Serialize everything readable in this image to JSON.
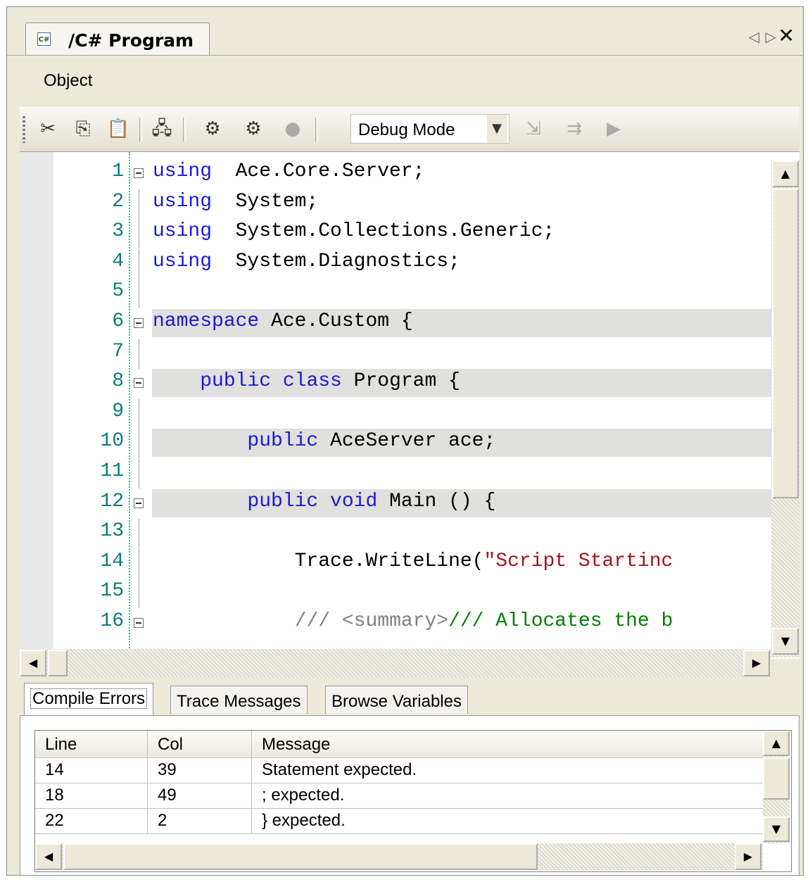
{
  "window": {
    "tab_title": "/C# Program",
    "tab_icon": "c-sharp-file-icon",
    "nav_prev": "◁",
    "nav_next": "▷",
    "close": "✕"
  },
  "menu": {
    "items": [
      {
        "label": "Object"
      }
    ]
  },
  "toolbar": {
    "mode": "Debug Mode",
    "icons": [
      "cut-icon",
      "copy-icon",
      "paste-icon",
      "deploy-icon",
      "compile-icon",
      "run-icon",
      "stop-icon",
      "step-into-icon",
      "step-over-icon",
      "play-icon"
    ]
  },
  "editor": {
    "lines": [
      {
        "n": "1",
        "tokens": [
          [
            "kw",
            "using"
          ],
          [
            "",
            "  Ace.Core.Server;"
          ]
        ]
      },
      {
        "n": "2",
        "tokens": [
          [
            "kw",
            "using"
          ],
          [
            "",
            "  System;"
          ]
        ]
      },
      {
        "n": "3",
        "tokens": [
          [
            "kw",
            "using"
          ],
          [
            "",
            "  System.Collections.Generic;"
          ]
        ]
      },
      {
        "n": "4",
        "tokens": [
          [
            "kw",
            "using"
          ],
          [
            "",
            "  System.Diagnostics;"
          ]
        ]
      },
      {
        "n": "5",
        "tokens": []
      },
      {
        "n": "6",
        "tokens": [
          [
            "kw",
            "namespace"
          ],
          [
            "",
            " Ace.Custom {"
          ]
        ]
      },
      {
        "n": "7",
        "tokens": []
      },
      {
        "n": "8",
        "tokens": [
          [
            "",
            "    "
          ],
          [
            "kw",
            "public class"
          ],
          [
            "",
            " Program {"
          ]
        ]
      },
      {
        "n": "9",
        "tokens": []
      },
      {
        "n": "10",
        "tokens": [
          [
            "",
            "        "
          ],
          [
            "kw",
            "public"
          ],
          [
            "",
            " AceServer ace;"
          ]
        ]
      },
      {
        "n": "11",
        "tokens": []
      },
      {
        "n": "12",
        "tokens": [
          [
            "",
            "        "
          ],
          [
            "kw",
            "public void"
          ],
          [
            "",
            " Main () {"
          ]
        ]
      },
      {
        "n": "13",
        "tokens": []
      },
      {
        "n": "14",
        "tokens": [
          [
            "",
            "            Trace.WriteLine("
          ],
          [
            "str",
            "\"Script Startinc"
          ]
        ]
      },
      {
        "n": "15",
        "tokens": []
      },
      {
        "n": "16",
        "tokens": [
          [
            "",
            "            "
          ],
          [
            "cm",
            "/// <summary>"
          ],
          [
            "cmg",
            "/// Allocates the b"
          ]
        ]
      }
    ]
  },
  "bottom_tabs": [
    {
      "label": "Compile Errors",
      "active": true
    },
    {
      "label": "Trace Messages",
      "active": false
    },
    {
      "label": "Browse Variables",
      "active": false
    }
  ],
  "errors_table": {
    "columns": [
      "Line",
      "Col",
      "Message"
    ],
    "rows": [
      [
        "14",
        "39",
        "Statement expected."
      ],
      [
        "18",
        "49",
        "; expected."
      ],
      [
        "22",
        "2",
        "} expected."
      ]
    ]
  }
}
